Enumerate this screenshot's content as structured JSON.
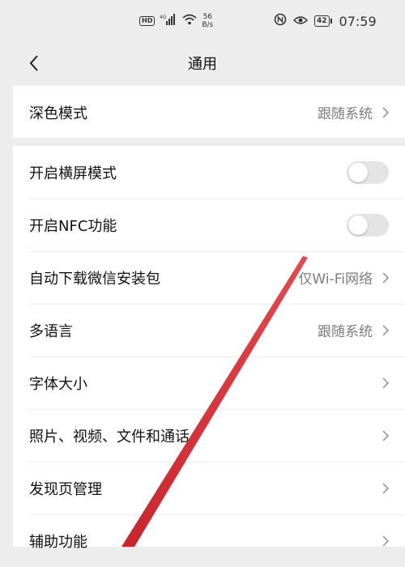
{
  "status_bar": {
    "hd": "HD",
    "network": "4G",
    "speed_value": "56",
    "speed_unit": "B/s",
    "battery": "42",
    "time": "07:59",
    "icons": [
      "hd-icon",
      "signal-icon",
      "wifi-icon",
      "nfc-icon",
      "eye-icon",
      "battery-icon"
    ]
  },
  "header": {
    "title": "通用",
    "back_icon": "chevron-left-icon"
  },
  "group1": {
    "dark_mode": {
      "label": "深色模式",
      "value": "跟随系统"
    }
  },
  "group2": {
    "landscape": {
      "label": "开启横屏模式",
      "enabled": false
    },
    "nfc": {
      "label": "开启NFC功能",
      "enabled": false
    },
    "auto_download": {
      "label": "自动下载微信安装包",
      "value": "仅Wi-Fi网络"
    },
    "language": {
      "label": "多语言",
      "value": "跟随系统"
    },
    "font_size": {
      "label": "字体大小"
    },
    "media": {
      "label": "照片、视频、文件和通话"
    },
    "discover": {
      "label": "发现页管理"
    },
    "accessibility": {
      "label": "辅助功能"
    }
  },
  "colors": {
    "background": "#ededed",
    "card": "#ffffff",
    "toggle_off": "#e4e4e4",
    "annotation_arrow": "#d9363e"
  }
}
